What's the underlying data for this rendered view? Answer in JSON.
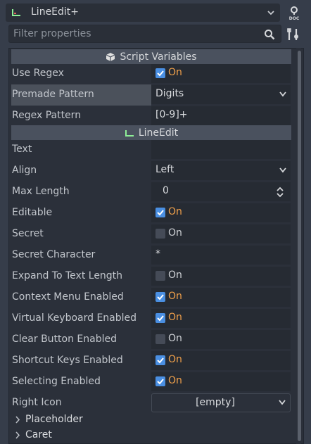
{
  "header": {
    "node_name": "LineEdit+",
    "filter_placeholder": "Filter properties"
  },
  "sections": {
    "script_variables": "Script Variables",
    "line_edit": "LineEdit"
  },
  "script_vars": {
    "use_regex": {
      "label": "Use Regex",
      "value": "On"
    },
    "premade_pattern": {
      "label": "Premade Pattern",
      "value": "Digits"
    },
    "regex_pattern": {
      "label": "Regex Pattern",
      "value": "[0-9]+"
    }
  },
  "props": {
    "text": {
      "label": "Text",
      "value": ""
    },
    "align": {
      "label": "Align",
      "value": "Left"
    },
    "max_length": {
      "label": "Max Length",
      "value": "0"
    },
    "editable": {
      "label": "Editable",
      "value": "On",
      "checked": true
    },
    "secret": {
      "label": "Secret",
      "value": "On",
      "checked": false
    },
    "secret_character": {
      "label": "Secret Character",
      "value": "*"
    },
    "expand_to_text_length": {
      "label": "Expand To Text Length",
      "value": "On",
      "checked": false
    },
    "context_menu_enabled": {
      "label": "Context Menu Enabled",
      "value": "On",
      "checked": true
    },
    "virtual_keyboard_enabled": {
      "label": "Virtual Keyboard Enabled",
      "value": "On",
      "checked": true
    },
    "clear_button_enabled": {
      "label": "Clear Button Enabled",
      "value": "On",
      "checked": false
    },
    "shortcut_keys_enabled": {
      "label": "Shortcut Keys Enabled",
      "value": "On",
      "checked": true
    },
    "selecting_enabled": {
      "label": "Selecting Enabled",
      "value": "On",
      "checked": true
    },
    "right_icon": {
      "label": "Right Icon",
      "value": "[empty]"
    }
  },
  "groups": {
    "placeholder": "Placeholder",
    "caret": "Caret"
  },
  "icons": {
    "node": "line-edit-icon",
    "node_dropdown": "chevron-down-icon",
    "docs": "help-docs-icon",
    "search": "search-icon",
    "tools": "tools-icon",
    "script_section": "cube-icon",
    "line_edit_section": "line-edit-icon",
    "group_expand": "chevron-right-icon"
  },
  "colors": {
    "checkbox_on": "#4a8fe2",
    "on_text": "#f0a04a",
    "line_edit_accent": "#8eef97",
    "panel_bg": "#2b303a",
    "section_bg": "#4a515e"
  }
}
